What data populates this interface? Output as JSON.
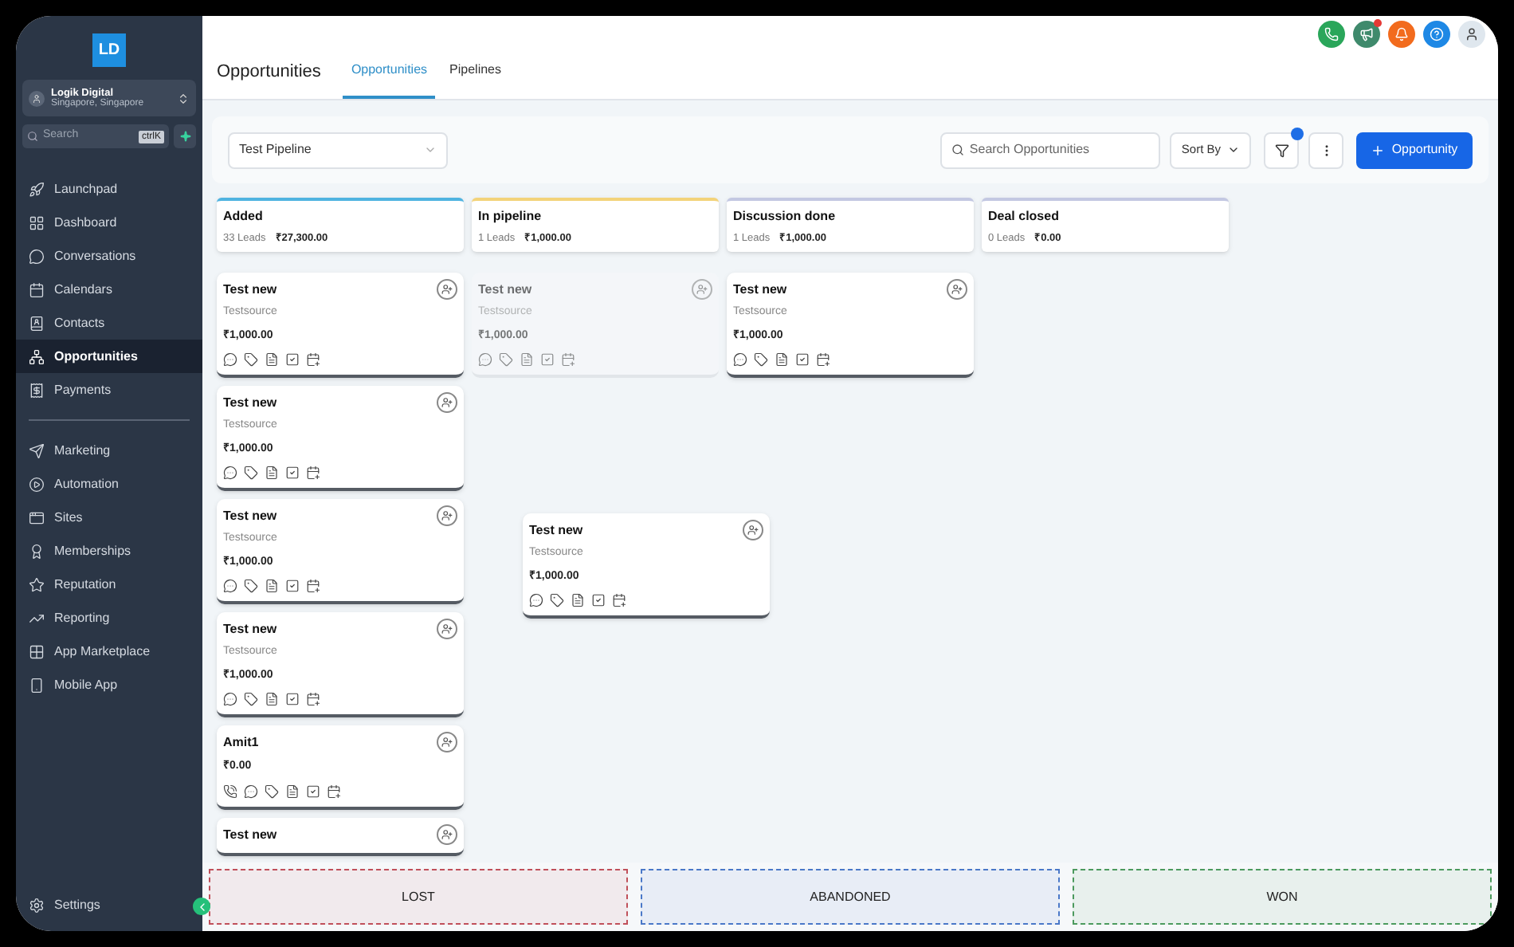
{
  "brand": {
    "logo": "LD"
  },
  "account": {
    "name": "Logik Digital",
    "location": "Singapore, Singapore"
  },
  "search": {
    "placeholder": "Search",
    "shortcut": "ctrlK"
  },
  "sidebar": {
    "groups": [
      {
        "items": [
          {
            "label": "Launchpad",
            "selected": false
          },
          {
            "label": "Dashboard",
            "selected": false
          },
          {
            "label": "Conversations",
            "selected": false
          },
          {
            "label": "Calendars",
            "selected": false
          },
          {
            "label": "Contacts",
            "selected": false
          },
          {
            "label": "Opportunities",
            "selected": true
          },
          {
            "label": "Payments",
            "selected": false
          }
        ]
      },
      {
        "items": [
          {
            "label": "Marketing",
            "selected": false
          },
          {
            "label": "Automation",
            "selected": false
          },
          {
            "label": "Sites",
            "selected": false
          },
          {
            "label": "Memberships",
            "selected": false
          },
          {
            "label": "Reputation",
            "selected": false
          },
          {
            "label": "Reporting",
            "selected": false
          },
          {
            "label": "App Marketplace",
            "selected": false
          },
          {
            "label": "Mobile App",
            "selected": false
          }
        ]
      }
    ],
    "settings": "Settings"
  },
  "header": {
    "title": "Opportunities",
    "tabs": [
      {
        "label": "Opportunities",
        "selected": true
      },
      {
        "label": "Pipelines",
        "selected": false
      }
    ],
    "actions": [
      {
        "kind": "phone",
        "badge": false
      },
      {
        "kind": "announcement",
        "badge": true
      },
      {
        "kind": "notifications",
        "badge": false
      },
      {
        "kind": "help",
        "badge": false
      },
      {
        "kind": "avatar",
        "badge": false
      }
    ]
  },
  "toolbar": {
    "pipeline": "Test Pipeline",
    "search_placeholder": "Search Opportunities",
    "sort": "Sort By",
    "filter_active": true,
    "add_button": "Opportunity"
  },
  "stages": [
    {
      "name": "Added",
      "leads": "33 Leads",
      "amount": "₹27,300.00",
      "color": "#4fb3e0",
      "cards": [
        {
          "title": "Test new",
          "source": "Testsource",
          "amount": "₹1,000.00",
          "call": false,
          "faded": false
        },
        {
          "title": "Test new",
          "source": "Testsource",
          "amount": "₹1,000.00",
          "call": false,
          "faded": false
        },
        {
          "title": "Test new",
          "source": "Testsource",
          "amount": "₹1,000.00",
          "call": false,
          "faded": false
        },
        {
          "title": "Test new",
          "source": "Testsource",
          "amount": "₹1,000.00",
          "call": false,
          "faded": false
        },
        {
          "title": "Amit1",
          "amount": "₹0.00",
          "call": true,
          "faded": false
        },
        {
          "title": "Test new",
          "faded": false
        }
      ]
    },
    {
      "name": "In pipeline",
      "leads": "1 Leads",
      "amount": "₹1,000.00",
      "color": "#f3d37a",
      "cards": [
        {
          "title": "Test new",
          "source": "Testsource",
          "amount": "₹1,000.00",
          "call": false,
          "faded": true
        }
      ]
    },
    {
      "name": "Discussion done",
      "leads": "1 Leads",
      "amount": "₹1,000.00",
      "color": "#c3c8e2",
      "cards": [
        {
          "title": "Test new",
          "source": "Testsource",
          "amount": "₹1,000.00",
          "call": false,
          "faded": false
        }
      ]
    },
    {
      "name": "Deal closed",
      "leads": "0 Leads",
      "amount": "₹0.00",
      "color": "#c3c8e2"
    }
  ],
  "dragged_card": {
    "title": "Test new",
    "source": "Testsource",
    "amount": "₹1,000.00",
    "call": false,
    "faded": false
  },
  "drop_zones": [
    {
      "label": "LOST",
      "color": "#c0505a"
    },
    {
      "label": "ABANDONED",
      "color": "#4a78c8"
    },
    {
      "label": "WON",
      "color": "#4c9a5e"
    }
  ]
}
